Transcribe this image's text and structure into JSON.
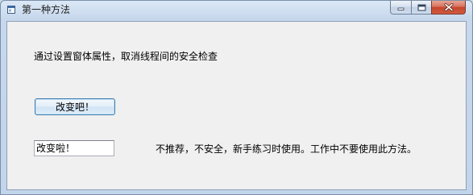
{
  "window": {
    "title": "第一种方法",
    "icon": "window-app-icon",
    "controls": [
      "minimize-icon",
      "maximize-icon",
      "close-icon"
    ]
  },
  "form": {
    "description": "通过设置窗体属性，取消线程间的安全检查",
    "button_label": "改变吧！",
    "textbox_value": "改变啦！",
    "note": "不推荐，不安全，新手练习时使用。工作中不要使用此方法。"
  },
  "colors": {
    "client_background": "#f0f0f0",
    "frame": "#c7d8ec",
    "close_button": "#c4452c"
  }
}
